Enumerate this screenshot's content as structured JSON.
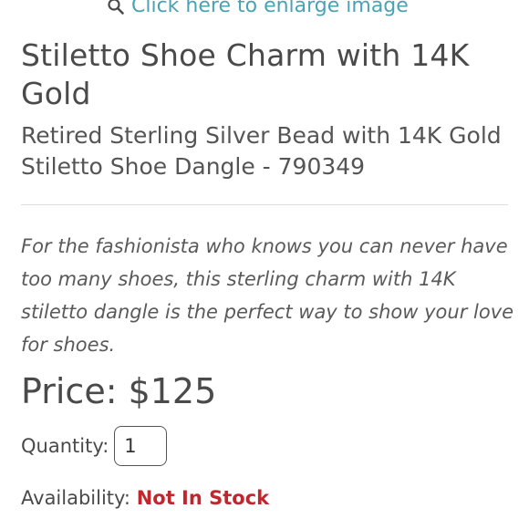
{
  "enlarge": {
    "label": "Click here to enlarge image",
    "icon": "search-icon"
  },
  "product": {
    "title": "Stiletto Shoe Charm with 14K Gold",
    "subtitle": "Retired Sterling Silver Bead with 14K Gold Stiletto Shoe Dangle - 790349",
    "description": "For the fashionista who knows you can never have too many shoes, this sterling charm with 14K stiletto dangle is the perfect way to show your love for shoes.",
    "price": "Price: $125"
  },
  "quantity": {
    "label": "Quantity:",
    "value": "1"
  },
  "availability": {
    "label": "Availability:",
    "status": "Not In Stock"
  },
  "colors": {
    "link": "#4aa3b3",
    "text": "#4a4a4a",
    "out_of_stock": "#c0262b"
  }
}
